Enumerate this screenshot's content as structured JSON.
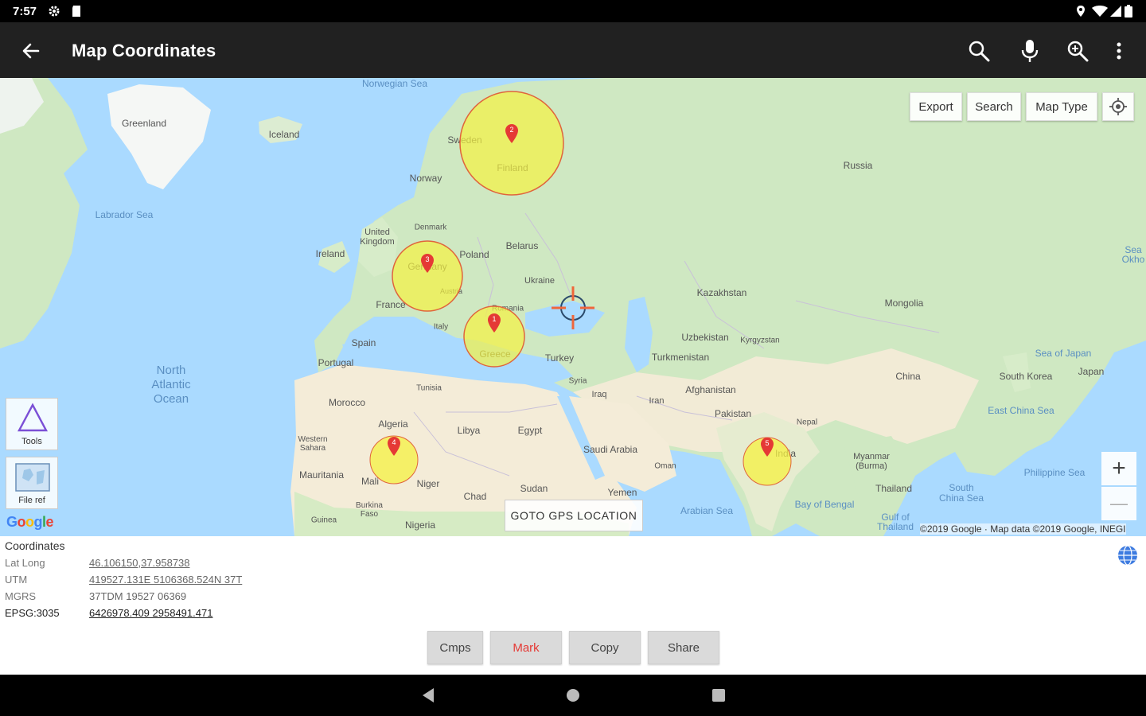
{
  "status_bar": {
    "time": "7:57"
  },
  "app_bar": {
    "title": "Map Coordinates"
  },
  "map": {
    "buttons": {
      "export": "Export",
      "search": "Search",
      "map_type": "Map Type"
    },
    "tools": {
      "tools_label": "Tools",
      "file_ref_label": "File ref"
    },
    "goto_label": "GOTO GPS LOCATION",
    "google": "Google",
    "copyright": "©2019 Google · Map data ©2019 Google, INEGI",
    "zoom_in": "+",
    "zoom_out": "—",
    "markers": [
      "2",
      "3",
      "1",
      "4",
      "5"
    ],
    "labels": {
      "greenland": "Greenland",
      "iceland": "Iceland",
      "norwegian_sea": "Norwegian Sea",
      "sweden": "Sweden",
      "finland": "Finland",
      "norway": "Norway",
      "russia": "Russia",
      "labrador_sea": "Labrador Sea",
      "denmark": "Denmark",
      "uk": "United\nKingdom",
      "ireland": "Ireland",
      "belarus": "Belarus",
      "poland": "Poland",
      "germany": "Germany",
      "ukraine": "Ukraine",
      "france": "France",
      "austria": "Austria",
      "romania": "Romania",
      "kazakhstan": "Kazakhstan",
      "mongolia": "Mongolia",
      "italy": "Italy",
      "spain": "Spain",
      "portugal": "Portugal",
      "greece": "Greece",
      "turkey": "Turkey",
      "uzbekistan": "Uzbekistan",
      "kyrgyzstan": "Kyrgyzstan",
      "turkmenistan": "Turkmenistan",
      "sea_japan": "Sea of Japan",
      "south_korea": "South Korea",
      "japan": "Japan",
      "china": "China",
      "afghanistan": "Afghanistan",
      "pakistan": "Pakistan",
      "nepal": "Nepal",
      "east_china_sea": "East China Sea",
      "tunisia": "Tunisia",
      "morocco": "Morocco",
      "syria": "Syria",
      "iraq": "Iraq",
      "iran": "Iran",
      "algeria": "Algeria",
      "libya": "Libya",
      "egypt": "Egypt",
      "saudi_arabia": "Saudi Arabia",
      "western_sahara": "Western\nSahara",
      "oman": "Oman",
      "india": "India",
      "myanmar": "Myanmar\n(Burma)",
      "mauritania": "Mauritania",
      "mali": "Mali",
      "niger": "Niger",
      "chad": "Chad",
      "sudan": "Sudan",
      "yemen": "Yemen",
      "thailand": "Thailand",
      "philippine_sea": "Philippine Sea",
      "south_china_sea": "South\nChina Sea",
      "arabian_sea": "Arabian Sea",
      "bay_bengal": "Bay of Bengal",
      "burkina_faso": "Burkina\nFaso",
      "nigeria": "Nigeria",
      "guinea": "Guinea",
      "gulf_thailand": "Gulf of\nThailand",
      "north_atlantic": "North\nAtlantic\nOcean",
      "sea_okhotsk": "Sea\nOkho"
    }
  },
  "coordinates": {
    "heading": "Coordinates",
    "rows": [
      {
        "label": "Lat Long",
        "value": "46.106150,37.958738"
      },
      {
        "label": "UTM",
        "value": "419527.131E 5106368.524N 37T"
      },
      {
        "label": "MGRS",
        "value": "37TDM 19527 06369"
      },
      {
        "label": "EPSG:3035",
        "value": "6426978.409 2958491.471"
      }
    ]
  },
  "actions": {
    "cmps": "Cmps",
    "mark": "Mark",
    "copy": "Copy",
    "share": "Share"
  },
  "colors": {
    "app_bar": "#212121",
    "mark_red": "#e53935",
    "water": "#aadaff",
    "land": "#cfe8c2",
    "desert": "#f4ecd8",
    "marker_circle": "#f5f242"
  }
}
